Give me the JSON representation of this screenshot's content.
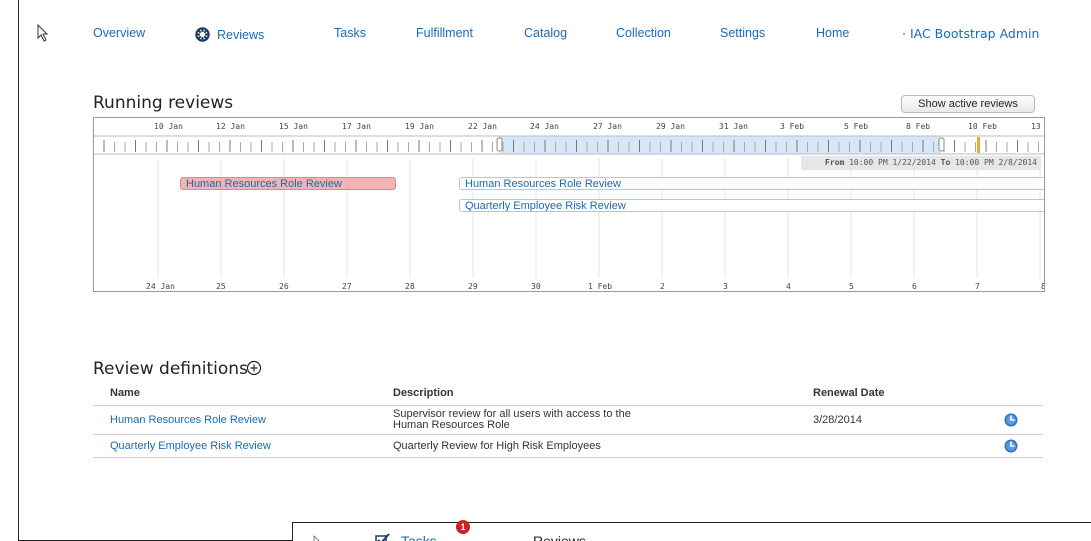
{
  "nav": {
    "items": [
      {
        "label": "Overview"
      },
      {
        "label": "Reviews",
        "active": true
      },
      {
        "label": "Tasks"
      },
      {
        "label": "Fulfillment"
      },
      {
        "label": "Catalog"
      },
      {
        "label": "Collection"
      },
      {
        "label": "Settings"
      },
      {
        "label": "Home"
      }
    ],
    "brand": "IAC Bootstrap Admin"
  },
  "running_reviews": {
    "title": "Running reviews",
    "show_active_button": "Show active reviews",
    "overview_ticks": [
      "10 Jan",
      "12 Jan",
      "15 Jan",
      "17 Jan",
      "19 Jan",
      "22 Jan",
      "24 Jan",
      "27 Jan",
      "29 Jan",
      "31 Jan",
      "3 Feb",
      "5 Feb",
      "8 Feb",
      "10 Feb",
      "13"
    ],
    "range": {
      "from_label": "From",
      "from": "10:00 PM 1/22/2014",
      "to_label": "To",
      "to": "10:00 PM 2/8/2014"
    },
    "detail_ticks": [
      "24 Jan",
      "25",
      "26",
      "27",
      "28",
      "29",
      "30",
      "1 Feb",
      "2",
      "3",
      "4",
      "5",
      "6",
      "7",
      "8"
    ],
    "events": [
      {
        "label": "Human Resources Role Review",
        "state": "past"
      },
      {
        "label": "Human Resources Role Review",
        "state": "current"
      },
      {
        "label": "Quarterly Employee Risk Review",
        "state": "current"
      }
    ]
  },
  "definitions": {
    "title": "Review definitions",
    "columns": {
      "name": "Name",
      "description": "Description",
      "renewal": "Renewal Date"
    },
    "rows": [
      {
        "name": "Human Resources Role Review",
        "description_line1": "Supervisor review for all users with access to the",
        "description_line2": "Human Resources Role",
        "renewal": "3/28/2014"
      },
      {
        "name": "Quarterly Employee Risk Review",
        "description_line1": "Quarterly Review for High Risk Employees",
        "description_line2": "",
        "renewal": ""
      }
    ]
  },
  "overlay": {
    "tasks_label": "Tasks",
    "badge_count": "1",
    "reviews_label": "Reviews"
  },
  "colors": {
    "link": "#1b6ab7",
    "past_event": "#f2b3b3",
    "selection": "#d6e8f7",
    "badge": "#cc2222"
  }
}
